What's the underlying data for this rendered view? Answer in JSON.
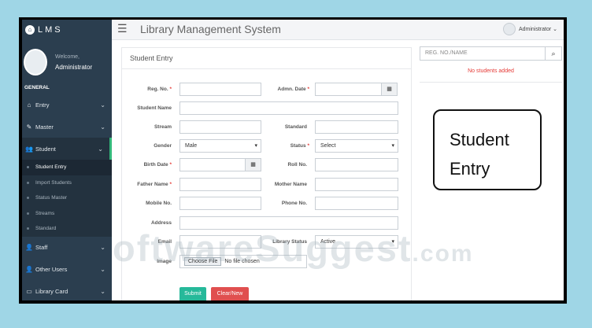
{
  "brand": {
    "name": "LMS"
  },
  "user": {
    "welcome": "Welcome,",
    "name": "Administrator"
  },
  "sidebar": {
    "section": "GENERAL",
    "items": [
      {
        "label": "Entry",
        "icon": "home-icon"
      },
      {
        "label": "Master",
        "icon": "edit-icon"
      },
      {
        "label": "Student",
        "icon": "users-icon",
        "active": true
      },
      {
        "label": "Staff",
        "icon": "user-icon"
      },
      {
        "label": "Other Users",
        "icon": "user-icon"
      },
      {
        "label": "Library Card",
        "icon": "card-icon"
      }
    ],
    "student_sub": [
      "Student Entry",
      "Import Students",
      "Status Master",
      "Streams",
      "Standard"
    ]
  },
  "topbar": {
    "title": "Library Management System",
    "admin": "Administrator"
  },
  "form": {
    "title": "Student Entry",
    "reg_no": "Reg. No.",
    "admn_date": "Admn. Date",
    "student_name": "Student Name",
    "stream": "Stream",
    "standard": "Standard",
    "gender": "Gender",
    "gender_value": "Male",
    "status": "Status",
    "status_value": "Select",
    "birth_date": "Birth Date",
    "roll_no": "Roll No.",
    "father_name": "Father Name",
    "mother_name": "Mother Name",
    "mobile_no": "Mobile No.",
    "phone_no": "Phone No.",
    "address": "Address",
    "email": "Email",
    "library_status": "Library Status",
    "library_status_value": "Active",
    "image": "Image",
    "choose_file": "Choose File",
    "no_file": "No file chosen",
    "required_mark": "*",
    "submit": "Submit",
    "clear": "Clear/New"
  },
  "right": {
    "search_placeholder": "REG. NO./NAME",
    "no_students": "No students added"
  },
  "callout": {
    "line1": "Student",
    "line2": "Entry"
  },
  "watermark": {
    "text": "oftwareSuggest",
    "suffix": ".com"
  },
  "colors": {
    "sidebar": "#2b3e4f",
    "submit": "#26b99a",
    "clear": "#e04f4f",
    "active_bar": "#33b87a"
  }
}
